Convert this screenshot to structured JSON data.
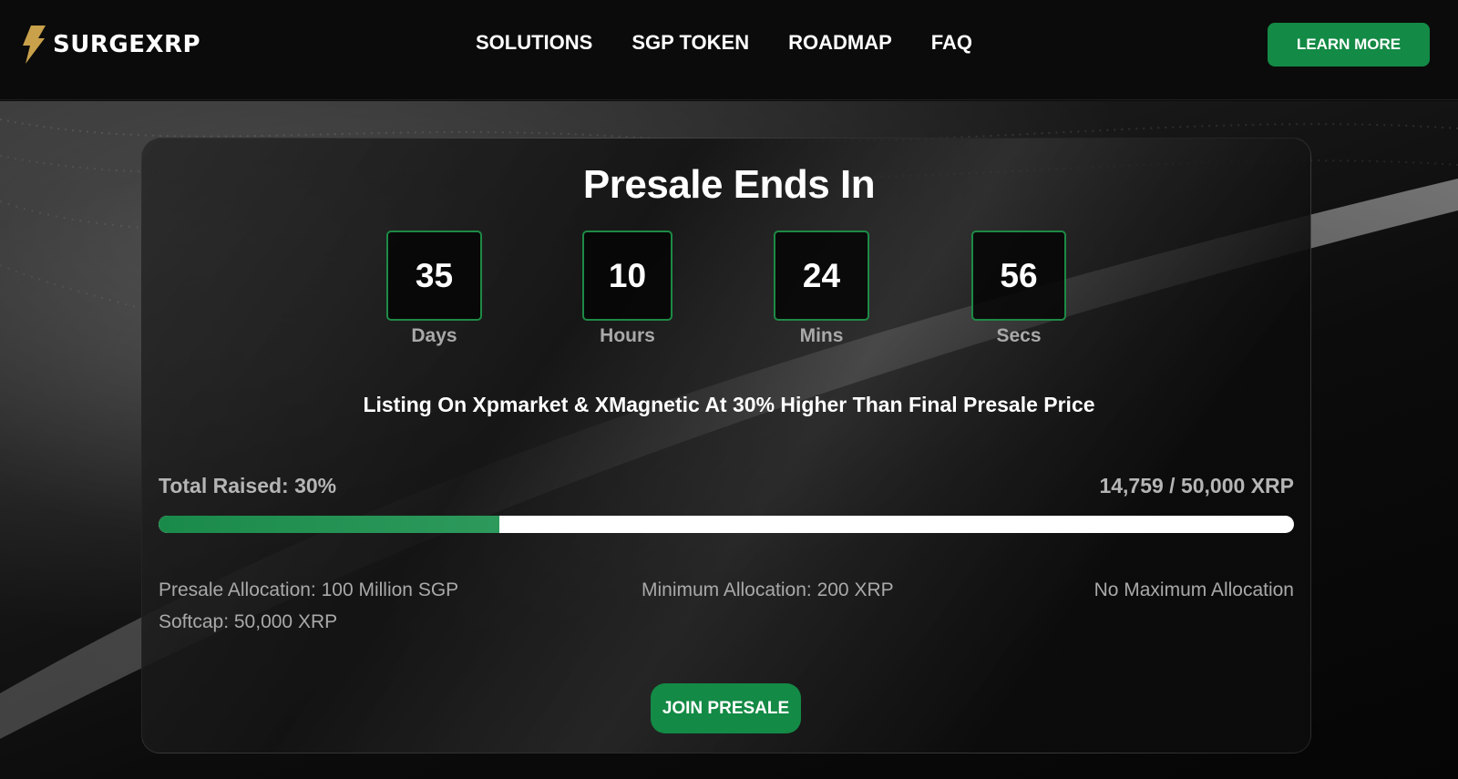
{
  "brand": {
    "name": "SURGEXRP",
    "logo_icon": "lightning-bolt-icon",
    "logo_color": "#c9a14a"
  },
  "nav": {
    "links": [
      "SOLUTIONS",
      "SGP TOKEN",
      "ROADMAP",
      "FAQ"
    ],
    "cta_label": "LEARN MORE"
  },
  "presale": {
    "title": "Presale Ends In",
    "countdown": [
      {
        "value": "35",
        "label": "Days"
      },
      {
        "value": "10",
        "label": "Hours"
      },
      {
        "value": "24",
        "label": "Mins"
      },
      {
        "value": "56",
        "label": "Secs"
      }
    ],
    "listing_note": "Listing On Xpmarket & XMagnetic At 30% Higher Than Final Presale Price",
    "raised_label": "Total Raised: 30%",
    "raised_amount": "14,759 / 50,000 XRP",
    "progress_fraction": 0.3,
    "allocation": "Presale Allocation: 100 Million SGP",
    "softcap": "Softcap: 50,000 XRP",
    "minimum": "Minimum Allocation: 200 XRP",
    "maximum": "No Maximum Allocation",
    "join_label": "JOIN PRESALE"
  },
  "colors": {
    "accent": "#138a45",
    "timer_border": "#1d8a45",
    "background": "#0a0a0a"
  }
}
